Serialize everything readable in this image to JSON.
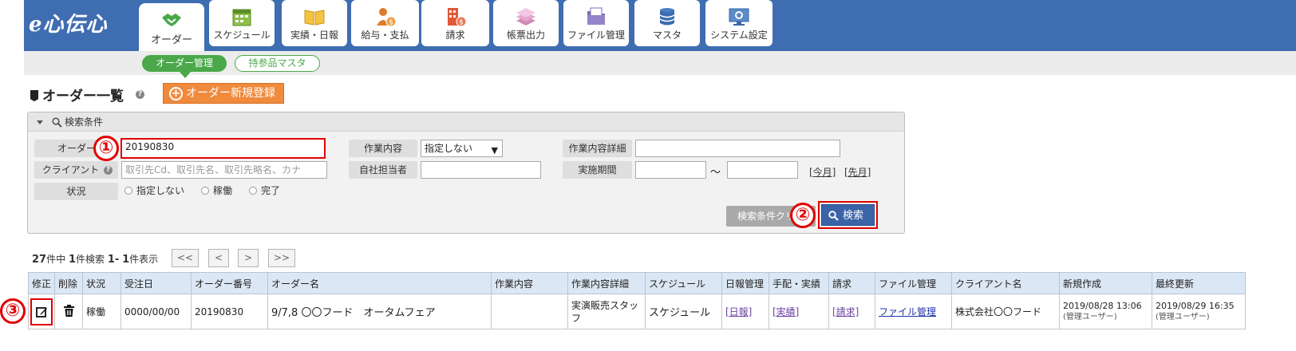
{
  "brand": {
    "logo": "e心伝心"
  },
  "nav": {
    "tabs": [
      {
        "label": "オーダー",
        "icon": "handshake-icon",
        "active": true
      },
      {
        "label": "スケジュール",
        "icon": "calendar-icon"
      },
      {
        "label": "実績・日報",
        "icon": "open-book-icon"
      },
      {
        "label": "給与・支払",
        "icon": "person-money-icon"
      },
      {
        "label": "請求",
        "icon": "building-money-icon"
      },
      {
        "label": "帳票出力",
        "icon": "stacked-documents-icon"
      },
      {
        "label": "ファイル管理",
        "icon": "folder-icon"
      },
      {
        "label": "マスタ",
        "icon": "database-icon"
      },
      {
        "label": "システム設定",
        "icon": "monitor-settings-icon"
      }
    ],
    "subtabs": [
      {
        "label": "オーダー管理",
        "active": true
      },
      {
        "label": "持参品マスタ",
        "active": false
      }
    ]
  },
  "page": {
    "title": "オーダー一覧",
    "new_button": "オーダー新規登録"
  },
  "search": {
    "header": "検索条件",
    "order_label": "オーダー",
    "order_value": "20190830",
    "client_label": "クライアント",
    "client_placeholder": "取引先Cd、取引先名、取引先略名、カナ",
    "status_label": "状況",
    "status_options": [
      "指定しない",
      "稼働",
      "完了"
    ],
    "work_label": "作業内容",
    "work_value": "指定しない",
    "staff_label": "自社担当者",
    "staff_value": "",
    "detail_label": "作業内容詳細",
    "detail_value": "",
    "period_label": "実施期間",
    "period_from": "",
    "period_sep": "～",
    "period_to": "",
    "this_month": "[今月]",
    "prev_month": "[先月]",
    "clear_button": "検索条件クリア",
    "search_button": "検索"
  },
  "callouts": [
    "①",
    "②",
    "③"
  ],
  "paging": {
    "total": "27",
    "total_suffix": "件中",
    "found": "1",
    "found_suffix": "件検索",
    "from": "1",
    "sep": "-",
    "to": "1",
    "to_suffix": "件表示",
    "first": "<<",
    "prev": "<",
    "next": ">",
    "last": ">>"
  },
  "table": {
    "headers": [
      "修正",
      "削除",
      "状況",
      "受注日",
      "オーダー番号",
      "オーダー名",
      "作業内容",
      "作業内容詳細",
      "スケジュール",
      "日報管理",
      "手配・実績",
      "請求",
      "ファイル管理",
      "クライアント名",
      "新規作成",
      "最終更新"
    ],
    "rows": [
      {
        "status": "稼働",
        "order_date": "0000/00/00",
        "order_no": "20190830",
        "order_name": "9/7,8 〇〇フード　オータムフェア",
        "work": "",
        "work_detail": "実演販売スタッフ",
        "schedule": "スケジュール",
        "daily": "[日報]",
        "arrange": "[実績]",
        "billing": "[請求]",
        "files": "ファイル管理",
        "client": "株式会社〇〇フード",
        "created": "2019/08/28 13:06",
        "created_by": "(管理ユーザー)",
        "updated": "2019/08/29 16:35",
        "updated_by": "(管理ユーザー)"
      }
    ]
  },
  "colors": {
    "header_blue": "#3f6db1",
    "accent_green": "#4aa84a",
    "accent_orange": "#f08a3c",
    "callout_red": "#e00000",
    "search_blue": "#3b64a8"
  }
}
